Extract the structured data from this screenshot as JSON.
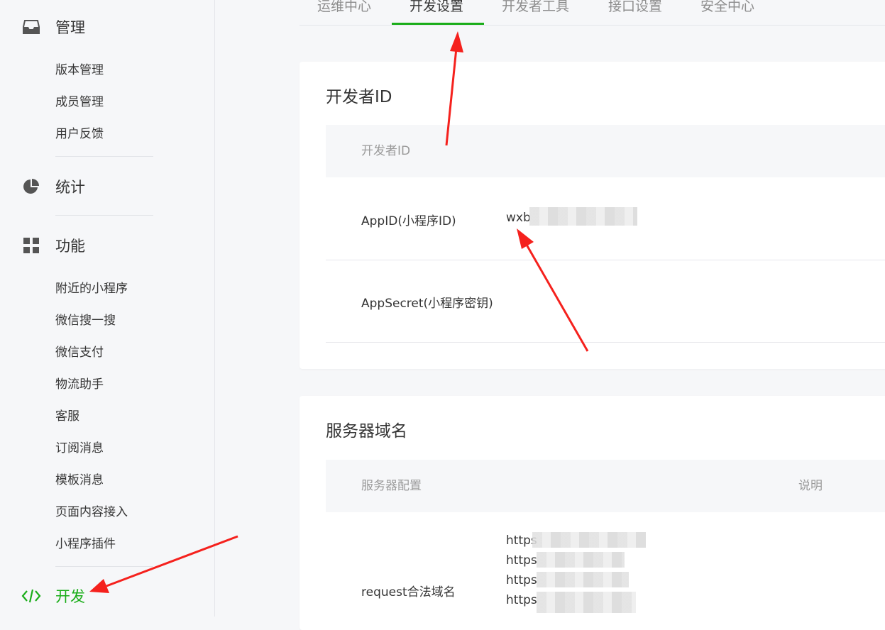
{
  "sidebar": {
    "groups": [
      {
        "label": "管理",
        "icon": "inbox-icon",
        "items": [
          "版本管理",
          "成员管理",
          "用户反馈"
        ]
      },
      {
        "label": "统计",
        "icon": "pie-chart-icon",
        "items": []
      },
      {
        "label": "功能",
        "icon": "grid-icon",
        "items": [
          "附近的小程序",
          "微信搜一搜",
          "微信支付",
          "物流助手",
          "客服",
          "订阅消息",
          "模板消息",
          "页面内容接入",
          "小程序插件"
        ]
      },
      {
        "label": "开发",
        "icon": "code-icon",
        "items": []
      }
    ]
  },
  "tabs": [
    {
      "label": "运维中心",
      "active": false
    },
    {
      "label": "开发设置",
      "active": true
    },
    {
      "label": "开发者工具",
      "active": false
    },
    {
      "label": "接口设置",
      "active": false
    },
    {
      "label": "安全中心",
      "active": false
    }
  ],
  "developer_id": {
    "title": "开发者ID",
    "header": "开发者ID",
    "rows": [
      {
        "label": "AppID(小程序ID)",
        "value": "wxb"
      },
      {
        "label": "AppSecret(小程序密钥)",
        "value": ""
      }
    ]
  },
  "server_domain": {
    "title": "服务器域名",
    "header_config": "服务器配置",
    "header_desc": "说明",
    "row_label": "request合法域名",
    "urls": [
      "https",
      "https",
      "https",
      "https"
    ]
  },
  "colors": {
    "accent": "#1aad19",
    "annotation": "#f5211d"
  }
}
